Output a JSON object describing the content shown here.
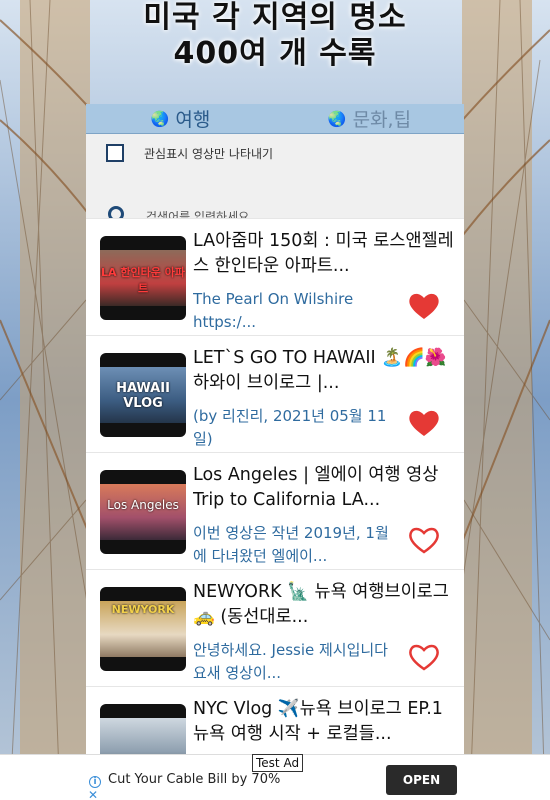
{
  "header": {
    "line1": "미국 각 지역의 명소",
    "line2": "400여 개 수록"
  },
  "tabs": [
    {
      "label": "여행",
      "icon": "globe-icon",
      "active": true
    },
    {
      "label": "문화,팁",
      "icon": "globe-icon",
      "active": false
    }
  ],
  "filters": {
    "favorites_only_label": "관심표시 영상만 나타내기",
    "search_placeholder": "검색어를 입력하세요."
  },
  "videos": [
    {
      "title": "LA아줌마 150회 : 미국 로스앤젤레스 한인타운 아파트...",
      "description": "The Pearl On Wilshire https:/...",
      "thumb_text": "LA 한인타운 아파트",
      "favorite": true
    },
    {
      "title": "LET`S GO TO HAWAII 🏝️🌈🌺 하와이 브이로그 |...",
      "description": "(by 리진리, 2021년 05월 11일)",
      "thumb_text": "HAWAII VLOG",
      "favorite": true
    },
    {
      "title": "Los Angeles | 엘에이 여행 영상 Trip to California LA...",
      "description": "이번 영상은 작년 2019년, 1월에 다녀왔던 엘에이...",
      "thumb_text": "Los Angeles",
      "favorite": false
    },
    {
      "title": "NEWYORK 🗽 뉴욕 여행브이로그🚕 (동선대로...",
      "description": "안녕하세요. Jessie 제시입니다 요새 영상이...",
      "thumb_text": "NEWYORK",
      "favorite": false
    },
    {
      "title": "NYC Vlog ✈️뉴욕 브이로그 EP.1 뉴욕 여행 시작 + 로컬들...",
      "description": "",
      "thumb_text": "",
      "favorite": false
    }
  ],
  "ad": {
    "badge": "Test Ad",
    "text": "Cut Your Cable Bill by 70%",
    "button": "OPEN"
  },
  "colors": {
    "tab_bar": "#a8c7e2",
    "heart": "#e53935",
    "link_text": "#2f6b9f"
  }
}
